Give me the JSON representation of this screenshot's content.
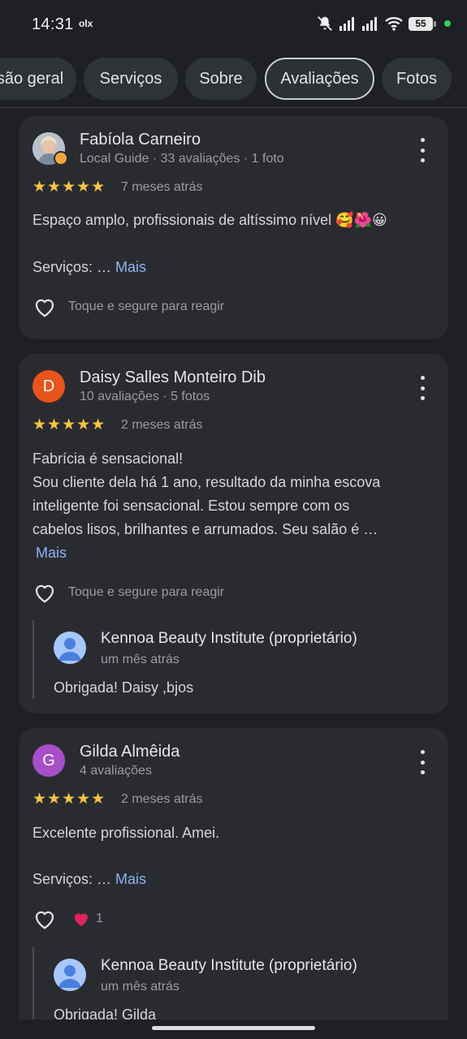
{
  "status": {
    "time": "14:31",
    "app_badge": "olx",
    "battery": "55"
  },
  "tabs": [
    {
      "label": "são geral",
      "active": false
    },
    {
      "label": "Serviços",
      "active": false
    },
    {
      "label": "Sobre",
      "active": false
    },
    {
      "label": "Avaliações",
      "active": true
    },
    {
      "label": "Fotos",
      "active": false
    }
  ],
  "reviews": [
    {
      "name": "Fabíola Carneiro",
      "meta": "Local Guide · 33 avaliações · 1 foto",
      "avatar_icon": "profile-photo",
      "stars": "★★★★★",
      "when": "7 meses atrás",
      "text": "Espaço amplo, profissionais de altíssimo nível 🥰🌺😀",
      "services_prefix": "Serviços: …",
      "more": "Mais",
      "react_label": "Toque e segure para reagir"
    },
    {
      "name": "Daisy Salles Monteiro Dib",
      "meta": "10 avaliações · 5 fotos",
      "avatar_letter": "D",
      "avatar_color": "#e8541b",
      "stars": "★★★★★",
      "when": "2 meses atrás",
      "text_lines": [
        "Fabrícia é sensacional!",
        "Sou cliente dela há 1 ano, resultado da minha escova",
        "inteligente foi sensacional. Estou sempre com os",
        "cabelos lisos, brilhantes e arrumados. Seu salão é …"
      ],
      "more": "Mais",
      "react_label": "Toque e segure para reagir",
      "owner_reply": {
        "name": "Kennoa Beauty Institute (proprietário)",
        "when": "um mês atrás",
        "text": "Obrigada! Daisy ,bjos"
      }
    },
    {
      "name": "Gilda Almêida",
      "meta": "4 avaliações",
      "avatar_letter": "G",
      "avatar_color": "#a64fc9",
      "stars": "★★★★★",
      "when": "2 meses atrás",
      "text": "Excelente profissional. Amei.",
      "services_prefix": "Serviços: …",
      "more": "Mais",
      "reaction_count": "1",
      "owner_reply": {
        "name": "Kennoa Beauty Institute (proprietário)",
        "when": "um mês atrás",
        "text": "Obrigada! Gilda"
      }
    }
  ],
  "colors": {
    "accent": "#8ab4f8",
    "star": "#f6c343",
    "heart_filled": "#e0245e"
  }
}
